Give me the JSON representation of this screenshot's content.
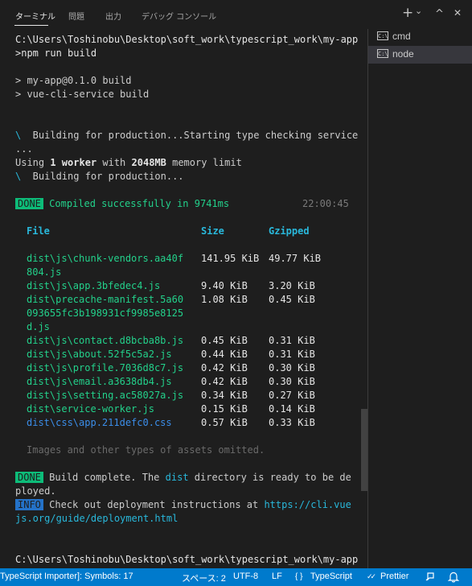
{
  "panel": {
    "tabs": [
      {
        "label": "ターミナル",
        "active": true
      },
      {
        "label": "問題",
        "active": false
      },
      {
        "label": "出力",
        "active": false
      },
      {
        "label": "デバッグ コンソール",
        "active": false
      }
    ],
    "controls": {
      "new_terminal": "+",
      "dropdown": "⌄",
      "maximize": "^",
      "close": "✕"
    }
  },
  "terminal": {
    "prompt_line_1": "C:\\Users\\Toshinobu\\Desktop\\soft_work\\typescript_work\\my-app",
    "prompt_line_2": ">npm run build",
    "script_line_1": "> my-app@0.1.0 build",
    "script_line_2": "> vue-cli-service build",
    "spinner": "\\",
    "building_1": "  Building for production...Starting type checking service",
    "building_1b": "...",
    "using_prefix": "Using ",
    "workers": "1 worker",
    "with_text": " with ",
    "memory": "2048MB",
    "memory_suffix": " memory limit",
    "building_2": "  Building for production...",
    "done_badge": "DONE",
    "compiled": "Compiled successfully in 9741ms",
    "timestamp": "22:00:45",
    "table_headers": {
      "file": "File",
      "size": "Size",
      "gzipped": "Gzipped"
    },
    "files": [
      {
        "lines": [
          "dist\\js\\chunk-vendors.aa40f",
          "804.js"
        ],
        "size": "141.95 KiB",
        "gzip": "49.77 KiB",
        "color": "green"
      },
      {
        "lines": [
          "dist\\js\\app.3bfedec4.js"
        ],
        "size": "9.40 KiB",
        "gzip": "3.20 KiB",
        "color": "green"
      },
      {
        "lines": [
          "dist\\precache-manifest.5a60",
          "093655fc3b198931cf9985e8125",
          "d.js"
        ],
        "size": "1.08 KiB",
        "gzip": "0.45 KiB",
        "color": "green"
      },
      {
        "lines": [
          "dist\\js\\contact.d8bcba8b.js"
        ],
        "size": "0.45 KiB",
        "gzip": "0.31 KiB",
        "color": "green"
      },
      {
        "lines": [
          "dist\\js\\about.52f5c5a2.js"
        ],
        "size": "0.44 KiB",
        "gzip": "0.31 KiB",
        "color": "green"
      },
      {
        "lines": [
          "dist\\js\\profile.7036d8c7.js"
        ],
        "size": "0.42 KiB",
        "gzip": "0.30 KiB",
        "color": "green"
      },
      {
        "lines": [
          "dist\\js\\email.a3638db4.js"
        ],
        "size": "0.42 KiB",
        "gzip": "0.30 KiB",
        "color": "green"
      },
      {
        "lines": [
          "dist\\js\\setting.ac58027a.js"
        ],
        "size": "0.34 KiB",
        "gzip": "0.27 KiB",
        "color": "green"
      },
      {
        "lines": [
          "dist\\service-worker.js"
        ],
        "size": "0.15 KiB",
        "gzip": "0.14 KiB",
        "color": "green"
      },
      {
        "lines": [
          "dist\\css\\app.211defc0.css"
        ],
        "size": "0.57 KiB",
        "gzip": "0.33 KiB",
        "color": "blue"
      }
    ],
    "omitted": "Images and other types of assets omitted.",
    "build_complete_pre": "Build complete. The ",
    "dist_word": "dist",
    "build_complete_post": " directory is ready to be de",
    "build_complete_wrap": "ployed.",
    "info_badge": "INFO",
    "deploy_text": "Check out deployment instructions at ",
    "deploy_url_1": "https://cli.vue",
    "deploy_url_2": "js.org/guide/deployment.html",
    "final_prompt": "C:\\Users\\Toshinobu\\Desktop\\soft_work\\typescript_work\\my-app"
  },
  "sidebar": {
    "items": [
      {
        "label": "cmd",
        "icon": "terminal-cmd-icon",
        "selected": false
      },
      {
        "label": "node",
        "icon": "terminal-node-icon",
        "selected": true
      }
    ]
  },
  "statusbar": {
    "importer": "TypeScript Importer]: Symbols: 17",
    "spaces": "スペース: 2",
    "encoding": "UTF-8",
    "eol": "LF",
    "language": "TypeScript",
    "prettier": "Prettier",
    "prettier_check": "✓✓"
  },
  "colors": {
    "accent": "#007acc",
    "green": "#23d18b",
    "cyan": "#29b8db",
    "blue": "#3b8eea",
    "done_bg": "#0dbc79",
    "info_bg": "#2472c8"
  }
}
